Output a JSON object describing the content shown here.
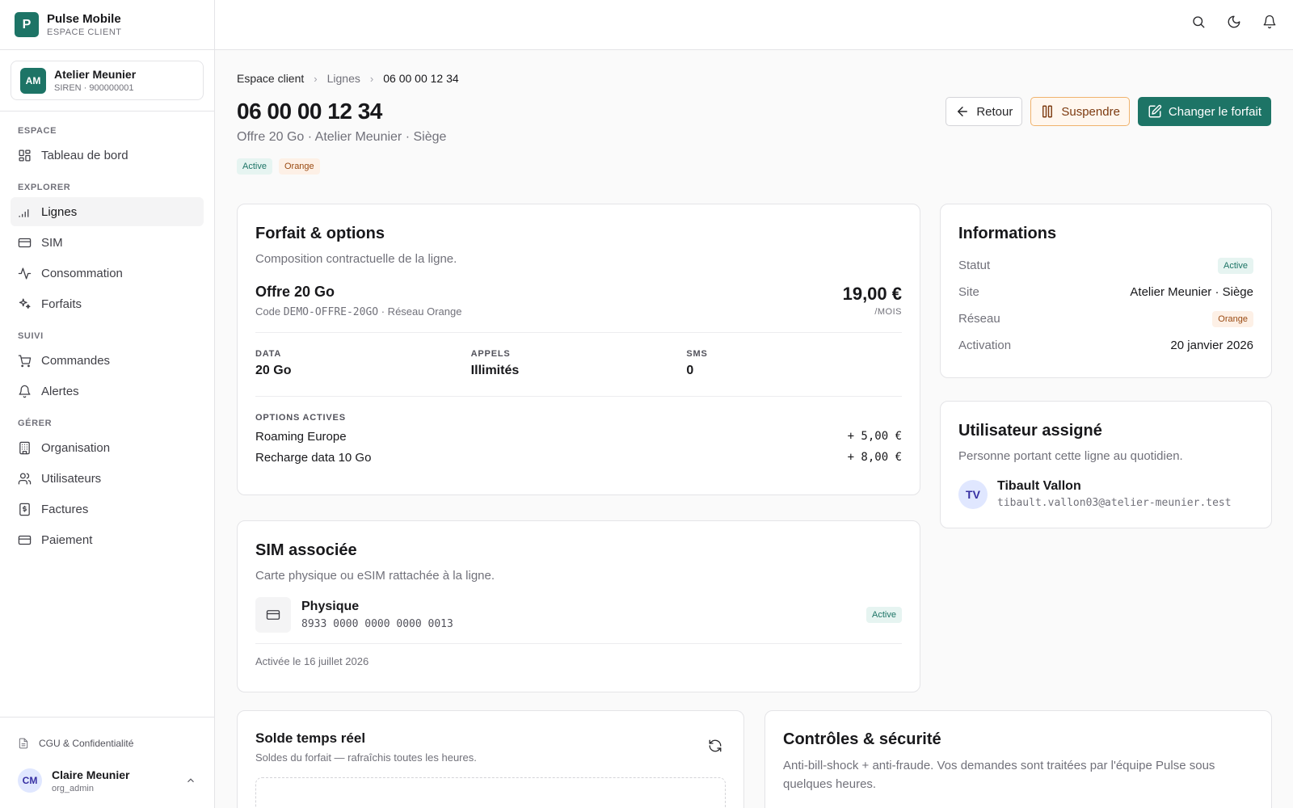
{
  "brand": {
    "logo_letter": "P",
    "name": "Pulse Mobile",
    "subtitle": "ESPACE CLIENT"
  },
  "org": {
    "initials": "AM",
    "name": "Atelier Meunier",
    "siren": "SIREN · 900000001"
  },
  "nav": {
    "sections": [
      {
        "title": "ESPACE",
        "items": [
          {
            "label": "Tableau de bord",
            "icon": "dashboard-icon"
          }
        ]
      },
      {
        "title": "EXPLORER",
        "items": [
          {
            "label": "Lignes",
            "icon": "signal-icon",
            "active": true
          },
          {
            "label": "SIM",
            "icon": "card-icon"
          },
          {
            "label": "Consommation",
            "icon": "activity-icon"
          },
          {
            "label": "Forfaits",
            "icon": "sparkles-icon"
          }
        ]
      },
      {
        "title": "SUIVI",
        "items": [
          {
            "label": "Commandes",
            "icon": "cart-icon"
          },
          {
            "label": "Alertes",
            "icon": "bell-icon"
          }
        ]
      },
      {
        "title": "GÉRER",
        "items": [
          {
            "label": "Organisation",
            "icon": "building-icon"
          },
          {
            "label": "Utilisateurs",
            "icon": "users-icon"
          },
          {
            "label": "Factures",
            "icon": "invoice-icon"
          },
          {
            "label": "Paiement",
            "icon": "card-icon"
          }
        ]
      }
    ]
  },
  "footer": {
    "legal": "CGU & Confidentialité",
    "user_initials": "CM",
    "user_name": "Claire Meunier",
    "user_role": "org_admin"
  },
  "breadcrumb": {
    "root": "Espace client",
    "parent": "Lignes",
    "current": "06 00 00 12 34"
  },
  "line": {
    "number": "06 00 00 12 34",
    "subtitle": "Offre 20 Go · Atelier Meunier · Siège",
    "badge_status": "Active",
    "badge_network": "Orange"
  },
  "actions": {
    "back": "Retour",
    "suspend": "Suspendre",
    "change": "Changer le forfait"
  },
  "forfait": {
    "title": "Forfait & options",
    "description": "Composition contractuelle de la ligne.",
    "offer_name": "Offre 20 Go",
    "code_prefix": "Code",
    "code": "DEMO-OFFRE-20GO",
    "network": "· Réseau Orange",
    "price": "19,00 €",
    "per": "/MOIS",
    "quotas": [
      {
        "label": "DATA",
        "value": "20 Go"
      },
      {
        "label": "APPELS",
        "value": "Illimités"
      },
      {
        "label": "SMS",
        "value": "0"
      }
    ],
    "options_title": "OPTIONS ACTIVES",
    "options": [
      {
        "name": "Roaming Europe",
        "price": "+ 5,00 €"
      },
      {
        "name": "Recharge data 10 Go",
        "price": "+ 8,00 €"
      }
    ]
  },
  "info": {
    "title": "Informations",
    "rows": [
      {
        "key": "Statut",
        "value": "Active",
        "type": "badge-active"
      },
      {
        "key": "Site",
        "value": "Atelier Meunier · Siège",
        "type": "text"
      },
      {
        "key": "Réseau",
        "value": "Orange",
        "type": "badge-orange"
      },
      {
        "key": "Activation",
        "value": "20 janvier 2026",
        "type": "text"
      }
    ]
  },
  "assigned": {
    "title": "Utilisateur assigné",
    "description": "Personne portant cette ligne au quotidien.",
    "initials": "TV",
    "name": "Tibault Vallon",
    "email": "tibault.vallon03@atelier-meunier.test"
  },
  "sim": {
    "title": "SIM associée",
    "description": "Carte physique ou eSIM rattachée à la ligne.",
    "type": "Physique",
    "iccid": "8933 0000 0000 0000 0013",
    "status": "Active",
    "activated": "Activée le 16 juillet 2026"
  },
  "solde": {
    "title": "Solde temps réel",
    "description": "Soldes du forfait — rafraîchis toutes les heures."
  },
  "controls": {
    "title": "Contrôles & sécurité",
    "description": "Anti-bill-shock + anti-fraude. Vos demandes sont traitées par l'équipe Pulse sous quelques heures."
  }
}
